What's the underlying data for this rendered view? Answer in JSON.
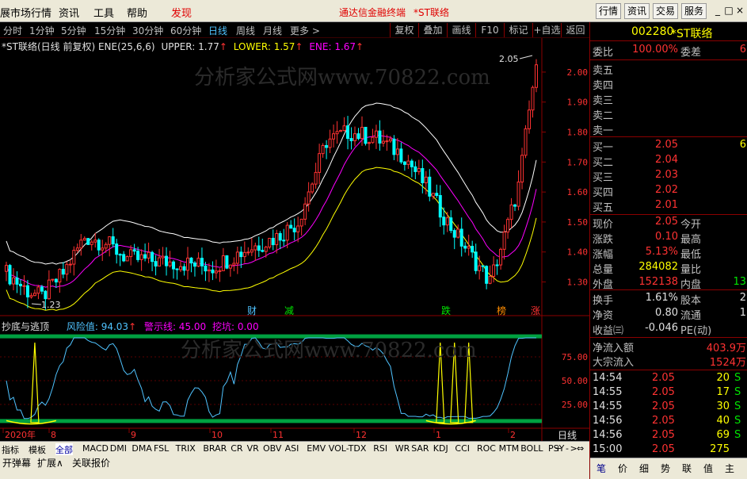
{
  "menubar": {
    "items": [
      "展市场行情",
      "资讯",
      "工具",
      "帮助"
    ],
    "discover": "发现",
    "app_title": "通达信金融终端",
    "stock_title": "*ST联络",
    "right_buttons": [
      "行情",
      "资讯",
      "交易",
      "服务"
    ],
    "window_controls": [
      "_",
      "□",
      "×"
    ]
  },
  "period_toolbar": {
    "periods": [
      "分时",
      "1分钟",
      "5分钟",
      "15分钟",
      "30分钟",
      "60分钟",
      "日线",
      "周线",
      "月线",
      "更多 >"
    ],
    "active_period": "日线",
    "tools": [
      "复权",
      "叠加",
      "画线",
      "F10",
      "标记",
      "+自选",
      "返回"
    ]
  },
  "main_chart": {
    "header_name": "*ST联络(日线 前复权) ENE(25,6,6)",
    "upper_label": "UPPER: 1.77",
    "lower_label": "LOWER: 1.57",
    "ene_label": "ENE: 1.67",
    "price_ticks": [
      "2.00",
      "1.90",
      "1.80",
      "1.70",
      "1.60",
      "1.50",
      "1.40",
      "1.30"
    ],
    "high_label": "2.05",
    "low_label": "1.23",
    "event_markers": [
      {
        "text": "财",
        "color": "#4fc3ff"
      },
      {
        "text": "减",
        "color": "#00e600"
      },
      {
        "text": "跌",
        "color": "#00e600"
      },
      {
        "text": "榜",
        "color": "#ff8c00"
      },
      {
        "text": "涨",
        "color": "#ff3232"
      }
    ],
    "watermark": "分析家公式网www.70822.com"
  },
  "sub_chart": {
    "title": "抄底与逃顶",
    "risk_label": "风险值: 94.03",
    "warn_label": "警示线: 45.00",
    "dig_label": "挖坑: 0.00",
    "ticks": [
      "75.00",
      "50.00",
      "25.00"
    ],
    "watermark": "分析家公式网www.70822.com"
  },
  "x_axis": {
    "labels": [
      "2020年",
      "8",
      "9",
      "10",
      "11",
      "12",
      "1",
      "2"
    ],
    "right_label": "日线"
  },
  "indicator_tabs": {
    "items": [
      "指标",
      "模板",
      "全部",
      "MACD",
      "DMI",
      "DMA",
      "FSL",
      "TRIX",
      "BRAR",
      "CR",
      "VR",
      "OBV",
      "ASI",
      "EMV",
      "VOL-TDX",
      "RSI",
      "WR",
      "SAR",
      "KDJ",
      "CCI",
      "ROC",
      "MTM",
      "BOLL",
      "PSY",
      ">"
    ],
    "active": "全部",
    "controls": [
      "+",
      "-",
      "⇔"
    ]
  },
  "statusbar": {
    "items": [
      "开弹幕",
      "扩展∧",
      "关联报价"
    ]
  },
  "quote_panel": {
    "code": "002280",
    "name": "*ST联络",
    "weibi_label": "委比",
    "weibi_value": "100.00%",
    "weicha_label": "委差",
    "weicha_value": "6",
    "sell_levels": [
      "卖五",
      "卖四",
      "卖三",
      "卖二",
      "卖一"
    ],
    "buy_levels": [
      {
        "label": "买一",
        "price": "2.05",
        "vol": "6"
      },
      {
        "label": "买二",
        "price": "2.04",
        "vol": ""
      },
      {
        "label": "买三",
        "price": "2.03",
        "vol": ""
      },
      {
        "label": "买四",
        "price": "2.02",
        "vol": ""
      },
      {
        "label": "买五",
        "price": "2.01",
        "vol": ""
      }
    ],
    "stats": [
      {
        "l1": "现价",
        "v1": "2.05",
        "c1": "red",
        "l2": "今开",
        "v2": ""
      },
      {
        "l1": "涨跌",
        "v1": "0.10",
        "c1": "red",
        "l2": "最高",
        "v2": ""
      },
      {
        "l1": "涨幅",
        "v1": "5.13%",
        "c1": "red",
        "l2": "最低",
        "v2": ""
      },
      {
        "l1": "总量",
        "v1": "284082",
        "c1": "yel",
        "l2": "量比",
        "v2": ""
      },
      {
        "l1": "外盘",
        "v1": "152138",
        "c1": "red",
        "l2": "内盘",
        "v2": "13"
      }
    ],
    "stats2": [
      {
        "l1": "换手",
        "v1": "1.61%",
        "c1": "wht",
        "l2": "股本",
        "v2": "2"
      },
      {
        "l1": "净资",
        "v1": "0.80",
        "c1": "wht",
        "l2": "流通",
        "v2": "1"
      },
      {
        "l1": "收益㈢",
        "v1": "-0.046",
        "c1": "wht",
        "l2": "PE(动)",
        "v2": ""
      }
    ],
    "net_inflow_label": "净流入额",
    "net_inflow_value": "403.9万",
    "block_inflow_label": "大宗流入",
    "block_inflow_value": "1524万",
    "ticks": [
      {
        "time": "14:54",
        "price": "2.05",
        "vol": "20",
        "side": "S"
      },
      {
        "time": "14:55",
        "price": "2.05",
        "vol": "17",
        "side": "S"
      },
      {
        "time": "14:55",
        "price": "2.05",
        "vol": "30",
        "side": "S"
      },
      {
        "time": "14:56",
        "price": "2.05",
        "vol": "40",
        "side": "S"
      },
      {
        "time": "14:56",
        "price": "2.05",
        "vol": "69",
        "side": "S"
      },
      {
        "time": "15:00",
        "price": "2.05",
        "vol": "275",
        "side": ""
      }
    ],
    "bottom_tabs": [
      "笔",
      "价",
      "细",
      "势",
      "联",
      "值",
      "主"
    ]
  },
  "colors": {
    "up": "#ff3232",
    "down": "#00ffff",
    "upper_band": "#ffffff",
    "mid_band": "#ff00ff",
    "lower_band": "#ffff00",
    "risk_line": "#4fc3ff",
    "band_green": "#00a040",
    "signal_yellow": "#ffff00"
  },
  "chart_data": {
    "type": "candlestick",
    "x_range": [
      "2020-07",
      "2021-02"
    ],
    "ylim": [
      1.23,
      2.05
    ],
    "ticks": [
      "1.30",
      "1.40",
      "1.50",
      "1.60",
      "1.70",
      "1.80",
      "1.90",
      "2.00"
    ],
    "indicator": {
      "name": "ENE(25,6,6)",
      "upper": 1.77,
      "lower": 1.57,
      "ene": 1.67
    },
    "sub_indicator": {
      "name": "抄底与逃顶",
      "risk": 94.03,
      "warn": 45.0,
      "dig": 0.0,
      "ylim": [
        0,
        100
      ]
    }
  }
}
